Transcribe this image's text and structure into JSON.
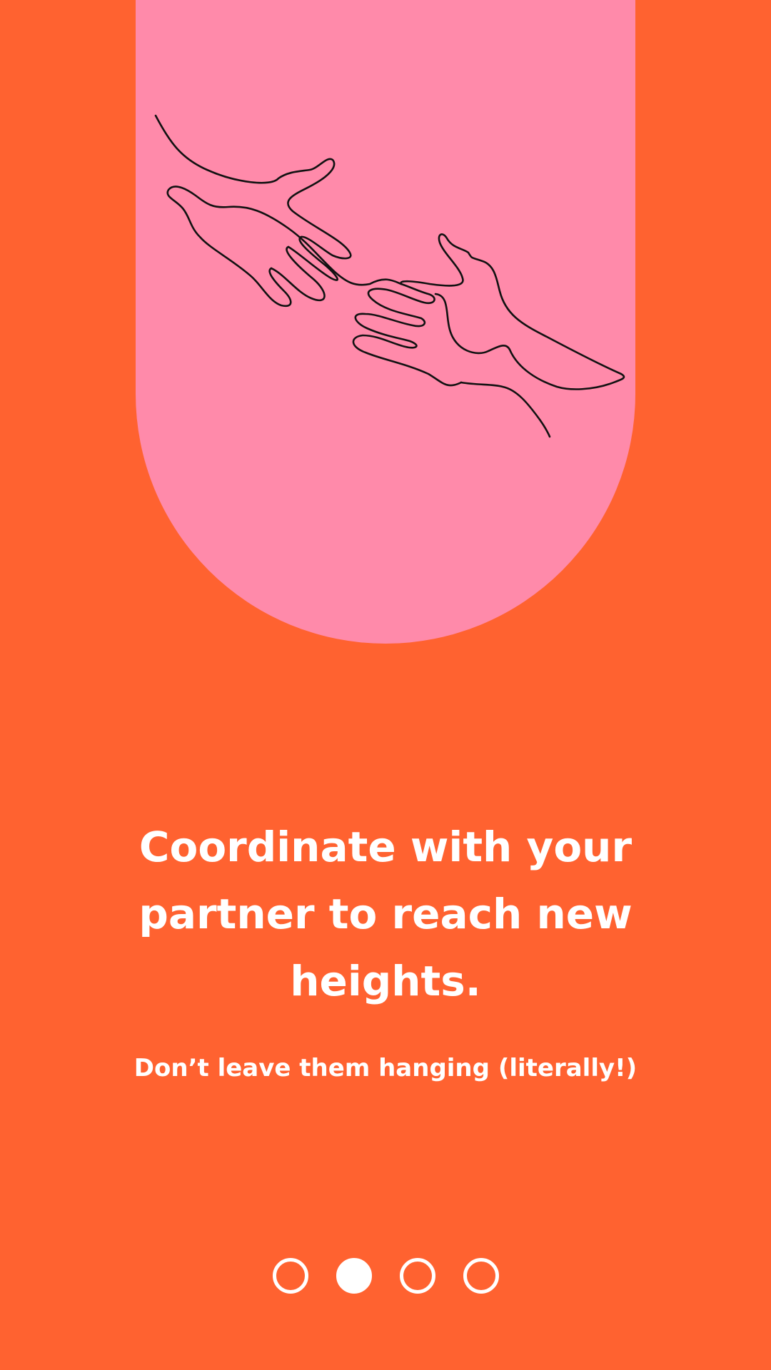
{
  "onboarding": {
    "illustration_icon": "reaching-hands-line-art",
    "headline": "Coordinate with your partner to reach new heights.",
    "subline": "Don’t leave them hanging (literally!)",
    "page_count": 4,
    "active_page": 2
  },
  "colors": {
    "background": "#ff6230",
    "card": "#ff8aaa",
    "text": "#ffffff",
    "line_art": "#111111"
  }
}
